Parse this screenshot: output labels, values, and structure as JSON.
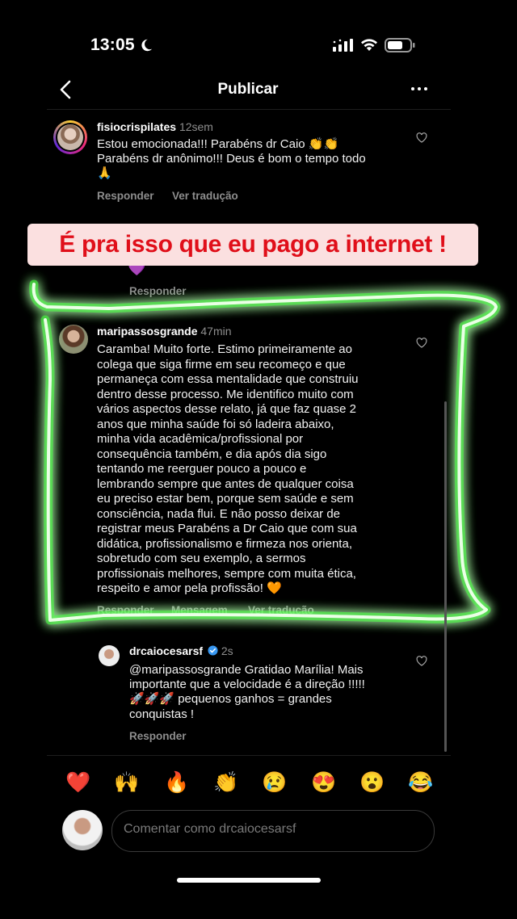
{
  "status_bar": {
    "time": "13:05"
  },
  "header": {
    "title": "Publicar"
  },
  "comments": [
    {
      "username": "fisiocrispilates",
      "time": "12sem",
      "text_lines": [
        "Estou emocionada!!! Parabéns dr Caio 👏👏",
        "Parabéns dr anônimo!!! Deus é bom o tempo todo",
        "🙏"
      ],
      "reply_label": "Responder",
      "translate_label": "Ver tradução"
    },
    {
      "partial_emoji": "💜",
      "reply_label": "Responder"
    },
    {
      "username": "maripassosgrande",
      "time": "47min",
      "text_lines": [
        "Caramba! Muito forte. Estimo primeiramente ao",
        "colega que siga firme em seu recomeço e que",
        "permaneça com essa mentalidade que construiu",
        "dentro desse processo. Me identifico muito com",
        "vários aspectos desse relato, já que faz quase 2",
        "anos que minha saúde foi só ladeira abaixo,",
        "minha vida acadêmica/profissional por",
        "consequência também, e dia após dia sigo",
        "tentando me reerguer pouco a pouco e",
        "lembrando sempre que antes de qualquer coisa",
        "eu preciso estar bem, porque sem saúde e sem",
        "consciência, nada flui. E não posso deixar de",
        "registrar meus Parabéns a Dr Caio que com sua",
        "didática, profissionalismo e firmeza nos orienta,",
        "sobretudo com seu exemplo, a sermos",
        "profissionais melhores, sempre com muita ética,",
        "respeito e amor pela profissão! 🧡"
      ],
      "reply_label": "Responder",
      "message_label": "Mensagem",
      "translate_label": "Ver tradução"
    },
    {
      "username": "drcaiocesarsf",
      "time": "2s",
      "text_lines": [
        "@maripassosgrande Gratidao Marília! Mais",
        "importante que a velocidade é a direção !!!!!",
        "🚀🚀🚀 pequenos ganhos = grandes",
        "conquistas !"
      ],
      "reply_label": "Responder"
    }
  ],
  "banner": {
    "text": "É pra isso que eu pago a internet !"
  },
  "reactions": [
    "❤️",
    "🙌",
    "🔥",
    "👏",
    "😢",
    "😍",
    "😮",
    "😂"
  ],
  "composer": {
    "placeholder": "Comentar como drcaiocesarsf"
  },
  "colors": {
    "background": "#000000",
    "banner_bg": "#fbe0e0",
    "banner_text": "#e00f1a",
    "neon_glow": "#2bff1e",
    "verified": "#3897f0"
  }
}
